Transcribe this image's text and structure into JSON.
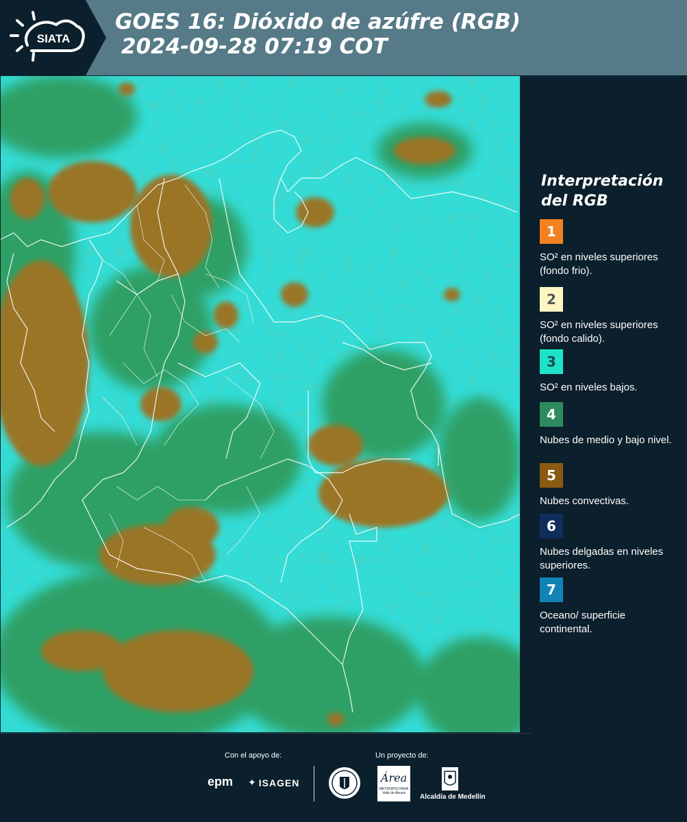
{
  "header": {
    "logo_text": "SIATA",
    "title_line1": "GOES 16: Dióxido de azúfre (RGB)",
    "title_line2": "2024-09-28 07:19 COT"
  },
  "legend": {
    "title_line1": "Interpretación",
    "title_line2": "del RGB",
    "items": [
      {
        "num": "1",
        "color": "#f4811f",
        "text_color": "#ffffff",
        "text": "SO² en niveles superiores (fondo frio)."
      },
      {
        "num": "2",
        "color": "#fdf6c3",
        "text_color": "#555555",
        "text": "SO² en niveles superiores (fondo calido)."
      },
      {
        "num": "3",
        "color": "#1ee3c8",
        "text_color": "#1a4a50",
        "text": "SO² en niveles bajos."
      },
      {
        "num": "4",
        "color": "#2e8a5e",
        "text_color": "#ffffff",
        "text": "Nubes de medio y bajo nivel."
      },
      {
        "num": "5",
        "color": "#8a5a10",
        "text_color": "#ffffff",
        "text": "Nubes convectivas."
      },
      {
        "num": "6",
        "color": "#0f2d5c",
        "text_color": "#ffffff",
        "text": "Nubes delgadas en niveles superiores."
      },
      {
        "num": "7",
        "color": "#1283b4",
        "text_color": "#ffffff",
        "text": "Oceano/ superficie continental."
      }
    ]
  },
  "footer": {
    "support_label": "Con el apoyo de:",
    "project_label": "Un proyecto de:",
    "sponsor1": "epm",
    "sponsor2": "ISAGEN",
    "partner1_line1": "METROPOLITANA",
    "partner1_line2": "Valle de Aburrá",
    "partner1_logo": "Área",
    "partner2": "Alcaldía de Medellín"
  },
  "map": {
    "colors": {
      "cyan": "#2de0dc",
      "green": "#2f9a5a",
      "brown": "#9a7428",
      "border": "#ffffff"
    }
  }
}
